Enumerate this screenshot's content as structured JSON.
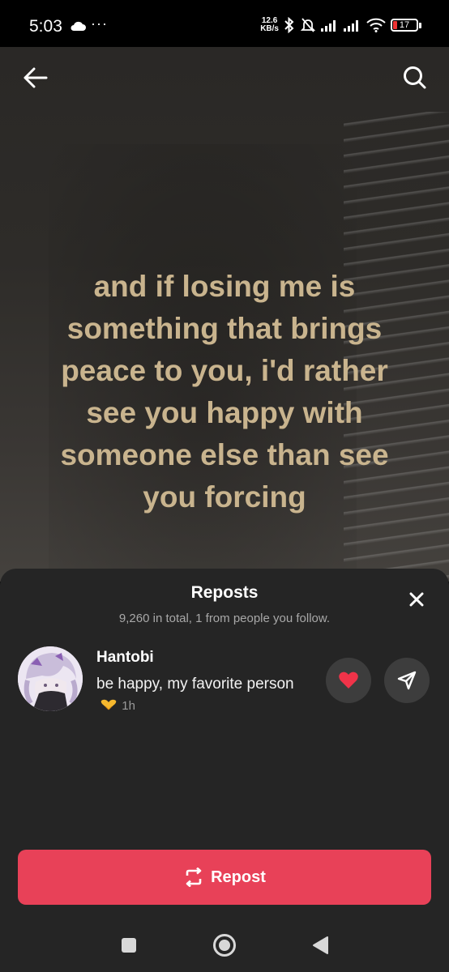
{
  "status_bar": {
    "time": "5:03",
    "more": "···",
    "net_speed_value": "12.6",
    "net_speed_unit": "KB/s",
    "battery_level": "17",
    "icons": [
      "cloud-icon",
      "bluetooth-icon",
      "mute-bell-icon",
      "signal-icon",
      "signal-icon",
      "wifi-icon",
      "battery-icon"
    ]
  },
  "video": {
    "caption": "and if losing me is something that brings peace to you, i'd rather see you happy with someone else than see you forcing",
    "caption_color": "#c9b48e"
  },
  "header": {
    "back_icon": "arrow-left-icon",
    "search_icon": "search-icon"
  },
  "sheet": {
    "title": "Reposts",
    "subtitle": "9,260 in total, 1 from people you follow.",
    "close_icon": "close-icon"
  },
  "repost_item": {
    "username": "Hantobi",
    "comment": "be happy, my favorite person",
    "emoji": "heart-hands-emoji",
    "time": "1h",
    "like_icon": "heart-icon",
    "share_icon": "send-icon"
  },
  "repost_button": {
    "label": "Repost",
    "icon": "repost-icon",
    "color": "#e84158"
  },
  "navbar": {
    "icons": [
      "square-icon",
      "circle-home-icon",
      "triangle-back-icon"
    ]
  }
}
